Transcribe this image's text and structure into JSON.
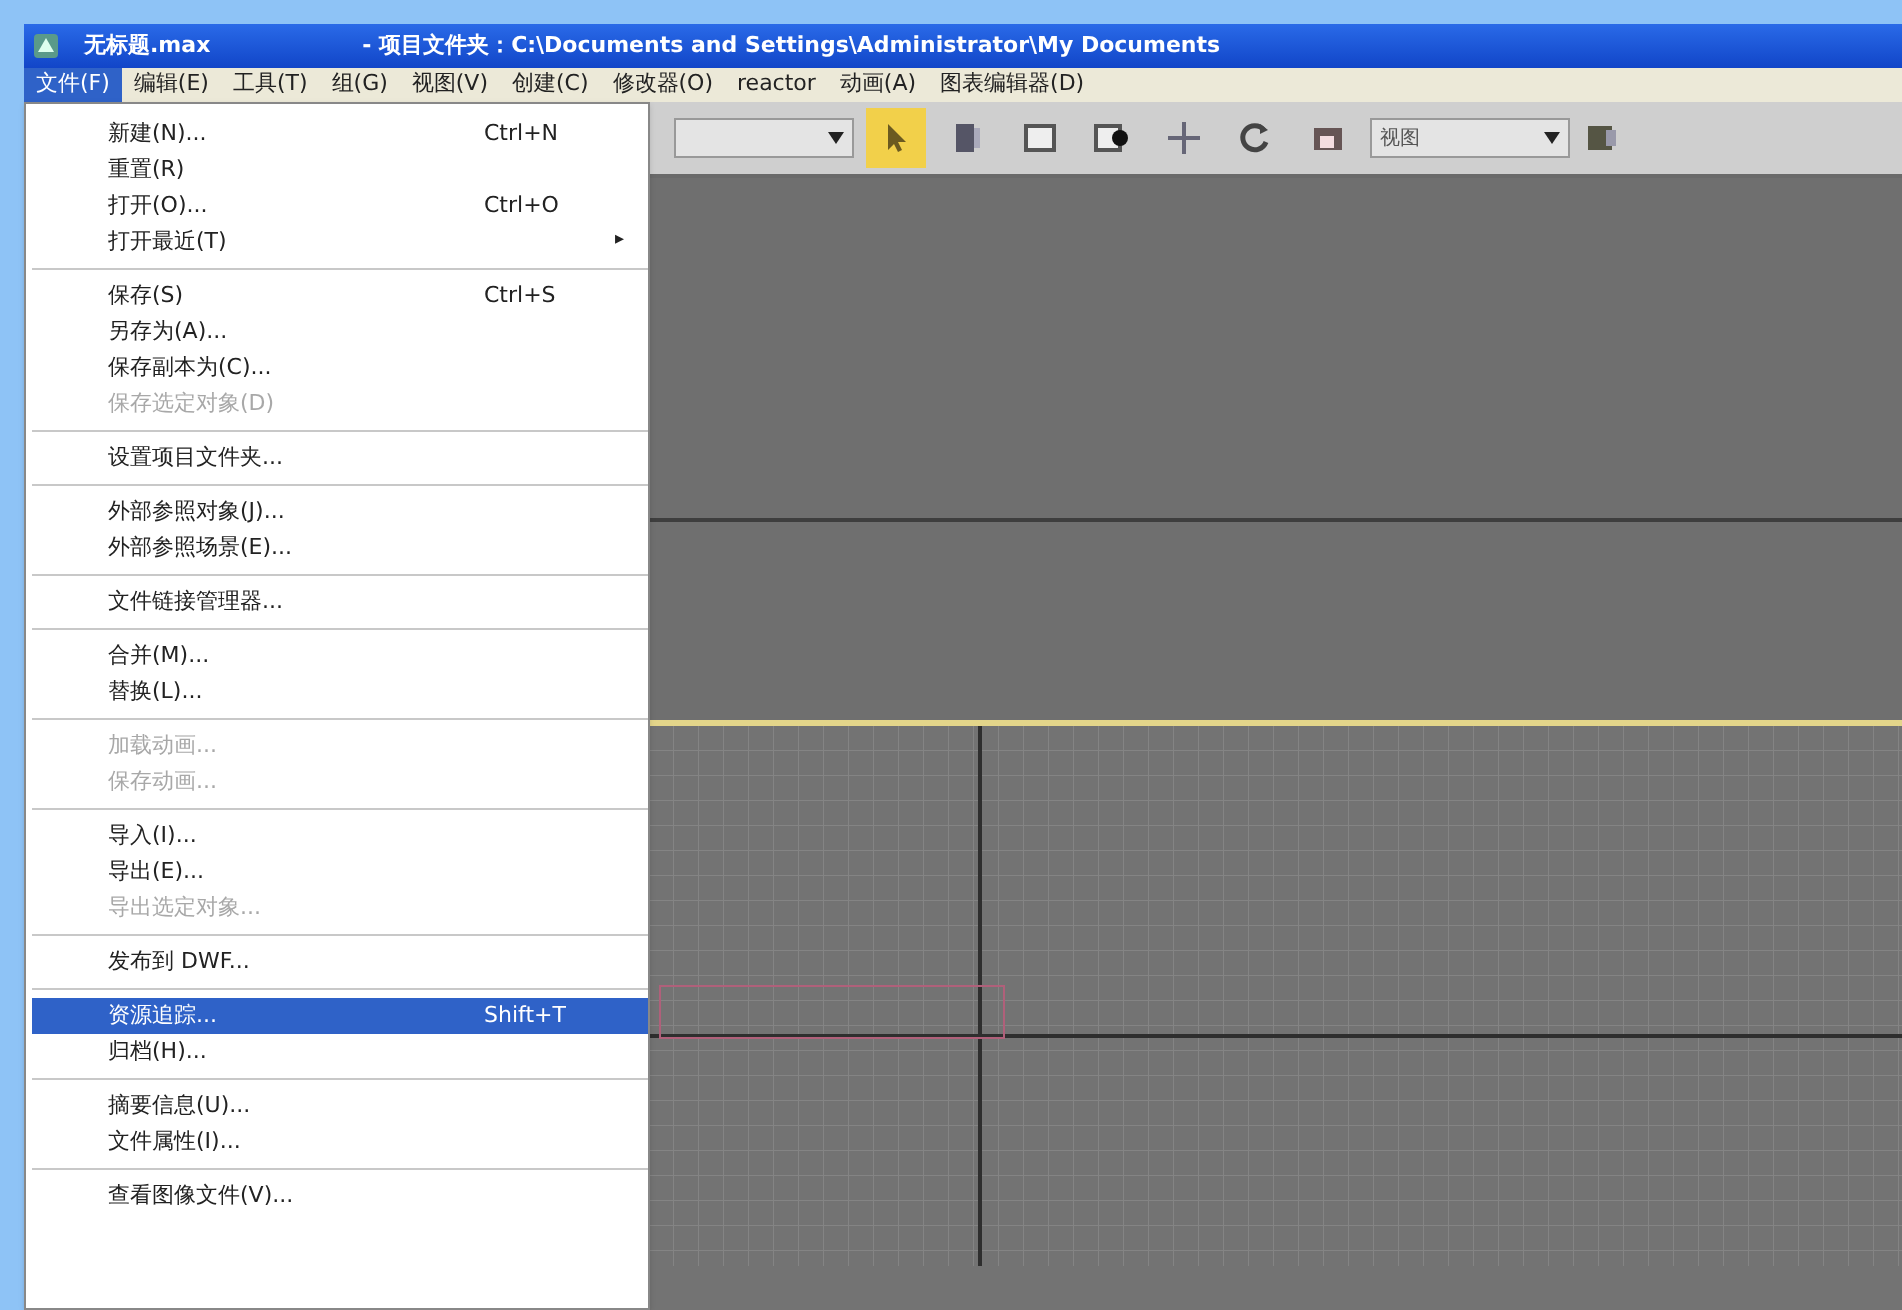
{
  "window": {
    "title": "无标题.max",
    "project_path": "- 项目文件夹：C:\\Documents and Settings\\Administrator\\My Documents"
  },
  "menu_bar": [
    {
      "label": "文件(F)",
      "selected": true
    },
    {
      "label": "编辑(E)",
      "selected": false
    },
    {
      "label": "工具(T)",
      "selected": false
    },
    {
      "label": "组(G)",
      "selected": false
    },
    {
      "label": "视图(V)",
      "selected": false
    },
    {
      "label": "创建(C)",
      "selected": false
    },
    {
      "label": "修改器(O)",
      "selected": false
    },
    {
      "label": "reactor",
      "selected": false
    },
    {
      "label": "动画(A)",
      "selected": false
    },
    {
      "label": "图表编辑器(D)",
      "selected": false
    }
  ],
  "file_menu": [
    [
      {
        "label": "新建(N)...",
        "shortcut": "Ctrl+N",
        "disabled": false,
        "selected": false
      },
      {
        "label": "重置(R)",
        "disabled": false,
        "selected": false
      },
      {
        "label": "打开(O)...",
        "shortcut": "Ctrl+O",
        "disabled": false,
        "selected": false
      },
      {
        "label": "打开最近(T)",
        "arrow": "▸",
        "disabled": false,
        "selected": false
      }
    ],
    [
      {
        "label": "保存(S)",
        "shortcut": "Ctrl+S",
        "disabled": false,
        "selected": false
      },
      {
        "label": "另存为(A)...",
        "disabled": false,
        "selected": false
      },
      {
        "label": "保存副本为(C)...",
        "disabled": false,
        "selected": false
      },
      {
        "label": "保存选定对象(D)",
        "disabled": true,
        "selected": false
      }
    ],
    [
      {
        "label": "设置项目文件夹...",
        "disabled": false,
        "selected": false
      }
    ],
    [
      {
        "label": "外部参照对象(J)...",
        "disabled": false,
        "selected": false
      },
      {
        "label": "外部参照场景(E)...",
        "disabled": false,
        "selected": false
      }
    ],
    [
      {
        "label": "文件链接管理器...",
        "disabled": false,
        "selected": false
      }
    ],
    [
      {
        "label": "合并(M)...",
        "disabled": false,
        "selected": false
      },
      {
        "label": "替换(L)...",
        "disabled": false,
        "selected": false
      }
    ],
    [
      {
        "label": "加载动画...",
        "disabled": true,
        "selected": false
      },
      {
        "label": "保存动画...",
        "disabled": true,
        "selected": false
      }
    ],
    [
      {
        "label": "导入(I)...",
        "disabled": false,
        "selected": false
      },
      {
        "label": "导出(E)...",
        "disabled": false,
        "selected": false
      },
      {
        "label": "导出选定对象...",
        "disabled": true,
        "selected": false
      }
    ],
    [
      {
        "label": "发布到 DWF...",
        "disabled": false,
        "selected": false
      }
    ],
    [
      {
        "label": "资源追踪...",
        "shortcut": "Shift+T",
        "disabled": false,
        "selected": true
      },
      {
        "label": "归档(H)...",
        "disabled": false,
        "selected": false
      }
    ],
    [
      {
        "label": "摘要信息(U)...",
        "disabled": false,
        "selected": false
      },
      {
        "label": "文件属性(I)...",
        "disabled": false,
        "selected": false
      }
    ],
    [
      {
        "label": "查看图像文件(V)...",
        "disabled": false,
        "selected": false
      }
    ]
  ],
  "toolbar": {
    "tools": [
      {
        "kind": "select",
        "selected": true
      },
      {
        "kind": "select-by-name",
        "selected": false
      },
      {
        "kind": "rect-region",
        "selected": false
      },
      {
        "kind": "window-crossing",
        "selected": false
      },
      {
        "kind": "move",
        "selected": false
      },
      {
        "kind": "rotate",
        "selected": false
      },
      {
        "kind": "scale",
        "selected": false
      }
    ],
    "coordinate_dropdown": "视图"
  }
}
